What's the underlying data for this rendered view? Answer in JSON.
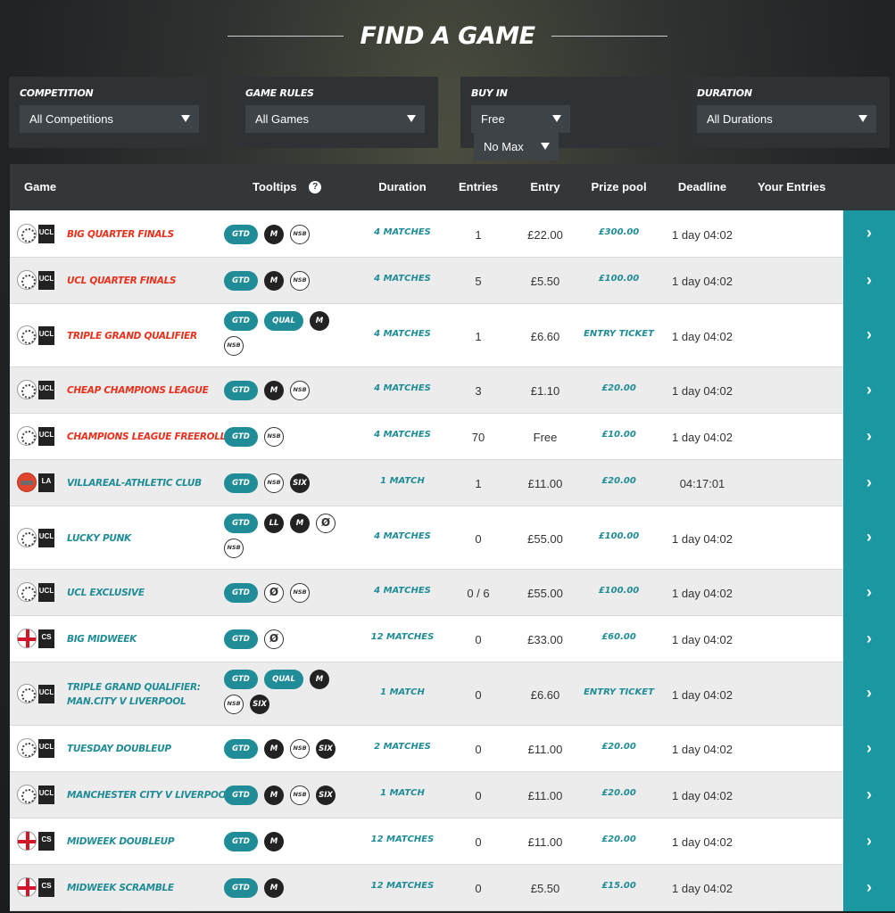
{
  "header": {
    "title": "FIND A GAME"
  },
  "filters": {
    "competition": {
      "label": "COMPETITION",
      "value": "All Competitions"
    },
    "game_rules": {
      "label": "GAME RULES",
      "value": "All Games"
    },
    "buy_in": {
      "label": "BUY IN",
      "min_value": "Free",
      "max_value": "No Max"
    },
    "duration": {
      "label": "DURATION",
      "value": "All Durations"
    }
  },
  "columns": {
    "game": "Game",
    "tooltips": "Tooltips",
    "duration": "Duration",
    "entries": "Entries",
    "entry": "Entry",
    "prize_pool": "Prize pool",
    "deadline": "Deadline",
    "your_entries": "Your Entries",
    "help": "?"
  },
  "rows": [
    {
      "comp": "UCL",
      "icon": "ucl",
      "name_color": "red",
      "name": [
        "BIG QUARTER FINALS"
      ],
      "tags": [
        "GTD",
        "M",
        "NSB"
      ],
      "duration": "4 MATCHES",
      "entries": "1",
      "entry": "£22.00",
      "prize": "£300.00",
      "deadline": "1 day 04:02",
      "go": "›"
    },
    {
      "comp": "UCL",
      "icon": "ucl",
      "name_color": "red",
      "name": [
        "UCL QUARTER FINALS"
      ],
      "tags": [
        "GTD",
        "M",
        "NSB"
      ],
      "duration": "4 MATCHES",
      "entries": "5",
      "entry": "£5.50",
      "prize": "£100.00",
      "deadline": "1 day 04:02",
      "go": "›"
    },
    {
      "comp": "UCL",
      "icon": "ucl",
      "name_color": "red",
      "name": [
        "TRIPLE GRAND QUALIFIER"
      ],
      "tags": [
        "GTD",
        "QUAL",
        "M",
        "NSB"
      ],
      "duration": "4 MATCHES",
      "entries": "1",
      "entry": "£6.60",
      "prize": "ENTRY TICKET",
      "deadline": "1 day 04:02",
      "go": "›"
    },
    {
      "comp": "UCL",
      "icon": "ucl",
      "name_color": "red",
      "name": [
        "CHEAP CHAMPIONS LEAGUE"
      ],
      "tags": [
        "GTD",
        "M",
        "NSB"
      ],
      "duration": "4 MATCHES",
      "entries": "3",
      "entry": "£1.10",
      "prize": "£20.00",
      "deadline": "1 day 04:02",
      "go": "›"
    },
    {
      "comp": "UCL",
      "icon": "ucl",
      "name_color": "red",
      "name": [
        "CHAMPIONS LEAGUE FREEROLL"
      ],
      "tags": [
        "GTD",
        "NSB"
      ],
      "duration": "4 MATCHES",
      "entries": "70",
      "entry": "Free",
      "prize": "£10.00",
      "deadline": "1 day 04:02",
      "go": "›"
    },
    {
      "comp": "LA",
      "icon": "la",
      "name_color": "teal",
      "name": [
        "VILLAREAL-ATHLETIC CLUB"
      ],
      "tags": [
        "GTD",
        "NSB",
        "SIX"
      ],
      "duration": "1 MATCH",
      "entries": "1",
      "entry": "£11.00",
      "prize": "£20.00",
      "deadline": "04:17:01",
      "go": "›"
    },
    {
      "comp": "UCL",
      "icon": "ucl",
      "name_color": "teal",
      "name": [
        "LUCKY PUNK"
      ],
      "tags": [
        "GTD",
        "LL",
        "M",
        "NOC",
        "NSB"
      ],
      "duration": "4 MATCHES",
      "entries": "0",
      "entry": "£55.00",
      "prize": "£100.00",
      "deadline": "1 day 04:02",
      "go": "›"
    },
    {
      "comp": "UCL",
      "icon": "ucl",
      "name_color": "teal",
      "name": [
        "UCL EXCLUSIVE"
      ],
      "tags": [
        "GTD",
        "NOC",
        "NSB"
      ],
      "duration": "4 MATCHES",
      "entries": "0 / 6",
      "entry": "£55.00",
      "prize": "£100.00",
      "deadline": "1 day 04:02",
      "go": "›"
    },
    {
      "comp": "CS",
      "icon": "cs",
      "name_color": "teal",
      "name": [
        "BIG MIDWEEK"
      ],
      "tags": [
        "GTD",
        "NOC"
      ],
      "duration": "12 MATCHES",
      "entries": "0",
      "entry": "£33.00",
      "prize": "£60.00",
      "deadline": "1 day 04:02",
      "go": "›"
    },
    {
      "comp": "UCL",
      "icon": "ucl",
      "name_color": "teal",
      "name": [
        "TRIPLE GRAND QUALIFIER:",
        "MAN.CITY V LIVERPOOL"
      ],
      "tags": [
        "GTD",
        "QUAL",
        "M",
        "NSB",
        "SIX"
      ],
      "duration": "1 MATCH",
      "entries": "0",
      "entry": "£6.60",
      "prize": "ENTRY TICKET",
      "deadline": "1 day 04:02",
      "go": "›"
    },
    {
      "comp": "UCL",
      "icon": "ucl",
      "name_color": "teal",
      "name": [
        "TUESDAY DOUBLEUP"
      ],
      "tags": [
        "GTD",
        "M",
        "NSB",
        "SIX"
      ],
      "duration": "2 MATCHES",
      "entries": "0",
      "entry": "£11.00",
      "prize": "£20.00",
      "deadline": "1 day 04:02",
      "go": "›"
    },
    {
      "comp": "UCL",
      "icon": "ucl",
      "name_color": "teal",
      "name": [
        "MANCHESTER CITY V LIVERPOOL"
      ],
      "tags": [
        "GTD",
        "M",
        "NSB",
        "SIX"
      ],
      "duration": "1 MATCH",
      "entries": "0",
      "entry": "£11.00",
      "prize": "£20.00",
      "deadline": "1 day 04:02",
      "go": "›"
    },
    {
      "comp": "CS",
      "icon": "cs",
      "name_color": "teal",
      "name": [
        "MIDWEEK DOUBLEUP"
      ],
      "tags": [
        "GTD",
        "M"
      ],
      "duration": "12 MATCHES",
      "entries": "0",
      "entry": "£11.00",
      "prize": "£20.00",
      "deadline": "1 day 04:02",
      "go": "›"
    },
    {
      "comp": "CS",
      "icon": "cs",
      "name_color": "teal",
      "name": [
        "MIDWEEK SCRAMBLE"
      ],
      "tags": [
        "GTD",
        "M"
      ],
      "duration": "12 MATCHES",
      "entries": "0",
      "entry": "£5.50",
      "prize": "£15.00",
      "deadline": "1 day 04:02",
      "go": "›"
    }
  ]
}
